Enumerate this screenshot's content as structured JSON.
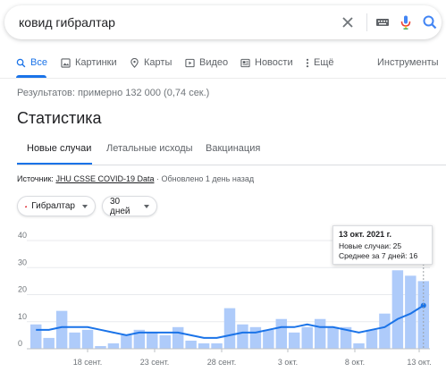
{
  "search": {
    "query": "ковид гибралтар"
  },
  "nav": {
    "tabs": [
      {
        "label": "Все",
        "icon": "search-icon"
      },
      {
        "label": "Картинки",
        "icon": "image-icon"
      },
      {
        "label": "Карты",
        "icon": "map-pin-icon"
      },
      {
        "label": "Видео",
        "icon": "video-icon"
      },
      {
        "label": "Новости",
        "icon": "news-icon"
      },
      {
        "label": "Ещё",
        "icon": "more-icon"
      }
    ],
    "tools": "Инструменты"
  },
  "results_stats": "Результатов: примерно 132 000 (0,74 сек.)",
  "stats": {
    "title": "Статистика",
    "tabs": [
      "Новые случаи",
      "Летальные исходы",
      "Вакцинация"
    ],
    "source_prefix": "Источник:",
    "source_link": "JHU CSSE COVID-19 Data",
    "source_updated": "· Обновлено 1 день назад",
    "region_chip": "Гибралтар",
    "period_chip": "30 дней"
  },
  "tooltip": {
    "date": "13 окт. 2021 г.",
    "new_cases": "Новые случаи: 25",
    "avg7": "Среднее за 7 дней: 16"
  },
  "colors": {
    "accent": "#1a73e8",
    "bar": "#aecbfa",
    "line": "#1a73e8",
    "flag_red": "#da000c"
  },
  "chart_data": {
    "type": "bar",
    "x": [
      "14 сент.",
      "15 сент.",
      "16 сент.",
      "17 сент.",
      "18 сент.",
      "19 сент.",
      "20 сент.",
      "21 сент.",
      "22 сент.",
      "23 сент.",
      "24 сент.",
      "25 сент.",
      "26 сент.",
      "27 сент.",
      "28 сент.",
      "29 сент.",
      "30 сент.",
      "1 окт.",
      "2 окт.",
      "3 окт.",
      "4 окт.",
      "5 окт.",
      "6 окт.",
      "7 окт.",
      "8 окт.",
      "9 окт.",
      "10 окт.",
      "11 окт.",
      "12 окт.",
      "13 окт."
    ],
    "series": [
      {
        "name": "Новые случаи",
        "type": "bar",
        "values": [
          9,
          4,
          14,
          6,
          7,
          1,
          2,
          5,
          7,
          6,
          5,
          8,
          3,
          2,
          2,
          15,
          9,
          8,
          7,
          11,
          6,
          8,
          11,
          8,
          8,
          2,
          7,
          13,
          29,
          27,
          25
        ]
      },
      {
        "name": "Среднее за 7 дней",
        "type": "line",
        "values": [
          7,
          7,
          8,
          8,
          8,
          7,
          6,
          5,
          6,
          6,
          6,
          6,
          5,
          4,
          4,
          5,
          6,
          6,
          7,
          8,
          8,
          9,
          8,
          8,
          7,
          6,
          7,
          8,
          11,
          13,
          16
        ]
      }
    ],
    "xticks": [
      "18 сент.",
      "23 сент.",
      "28 сент.",
      "3 окт.",
      "8 окт.",
      "13 окт."
    ],
    "yticks": [
      0,
      10,
      20,
      30,
      40
    ],
    "ylim": [
      0,
      40
    ],
    "grid": true
  }
}
